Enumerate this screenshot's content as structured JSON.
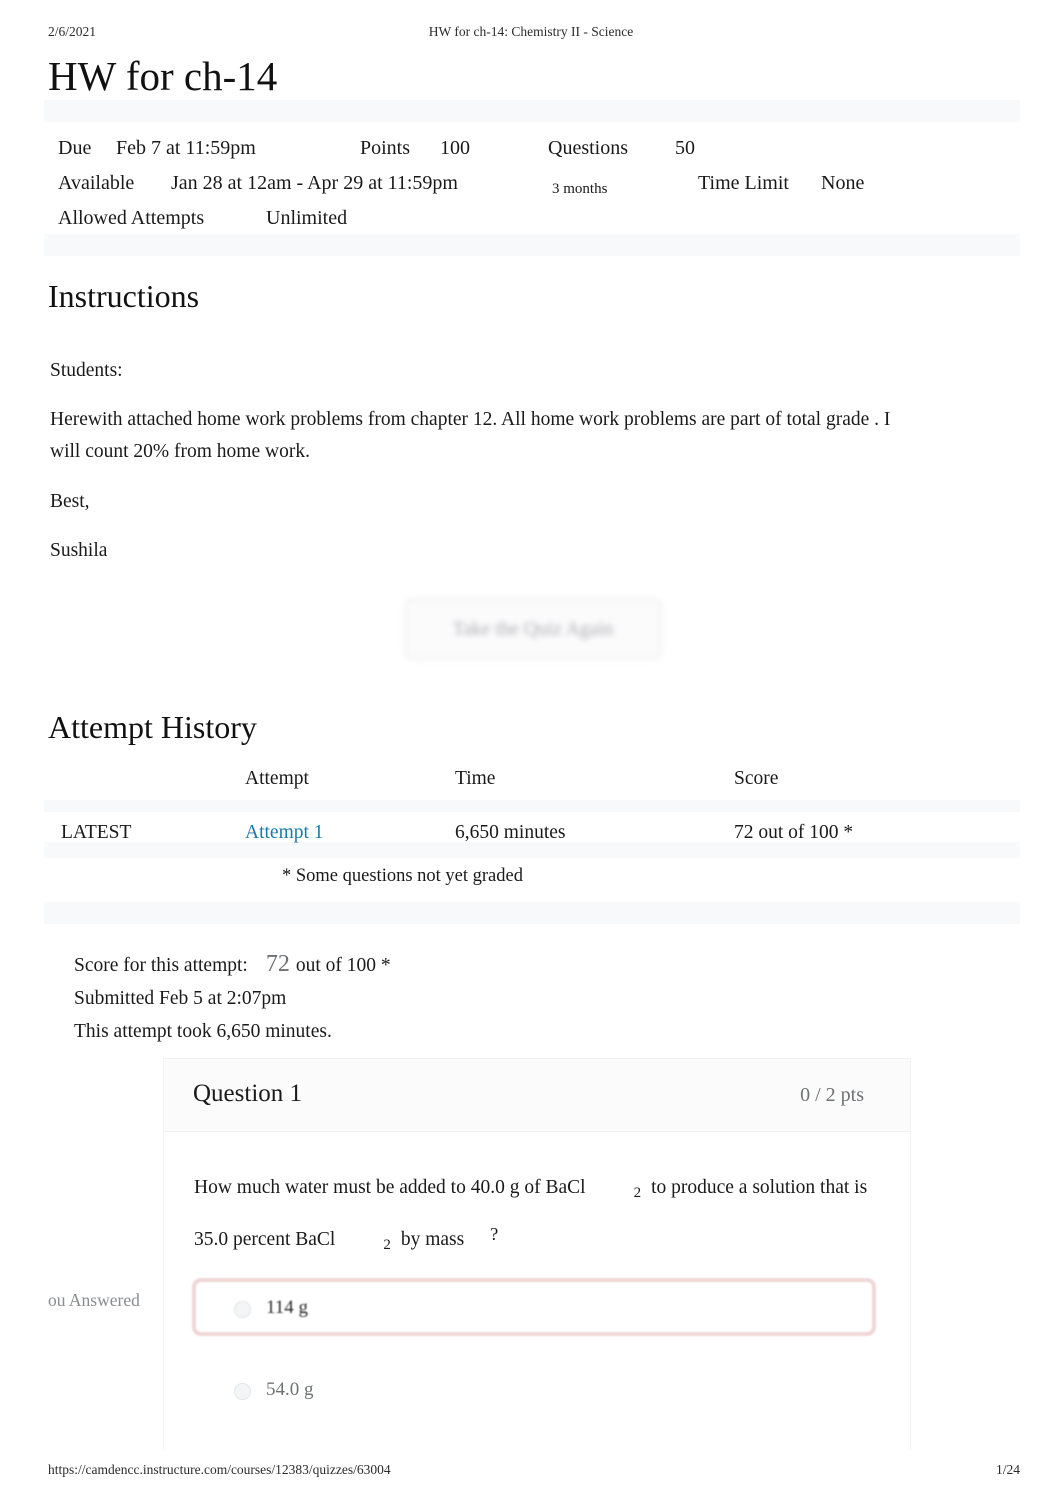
{
  "print": {
    "date": "2/6/2021",
    "doc_title": "HW for ch-14: Chemistry II - Science",
    "url": "https://camdencc.instructure.com/courses/12383/quizzes/63004",
    "page_number": "1/24"
  },
  "page": {
    "title": "HW for ch-14"
  },
  "quiz_meta": {
    "due_label": "Due",
    "due_value": "Feb 7 at 11:59pm",
    "points_label": "Points",
    "points_value": "100",
    "questions_label": "Questions",
    "questions_value": "50",
    "available_label": "Available",
    "available_value": "Jan 28 at 12am - Apr 29 at 11:59pm",
    "duration_value": "3 months",
    "time_limit_label": "Time Limit",
    "time_limit_value": "None",
    "allowed_attempts_label": "Allowed Attempts",
    "allowed_attempts_value": "Unlimited"
  },
  "instructions": {
    "heading": "Instructions",
    "salutation": "Students:",
    "body": "Herewith attached home work problems from chapter 12. All home work problems are part of total grade . I will count 20% from home work.",
    "closing": "Best,",
    "signature": "Sushila"
  },
  "actions": {
    "take_quiz_again": "Take the Quiz Again"
  },
  "attempt_history": {
    "heading": "Attempt History",
    "columns": [
      "",
      "Attempt",
      "Time",
      "Score"
    ],
    "rows": [
      {
        "marker": "LATEST",
        "attempt": "Attempt 1",
        "time": "6,650 minutes",
        "score": "72 out of 100 *"
      }
    ],
    "footnote": "* Some questions not yet graded"
  },
  "attempt_summary": {
    "score_label": "Score for this attempt:",
    "score_value": "72",
    "score_suffix": "out of 100 *",
    "submitted": "Submitted Feb 5 at 2:07pm",
    "duration": "This attempt took 6,650 minutes."
  },
  "question": {
    "title": "Question 1",
    "points": "0 / 2 pts",
    "text_part1": "How much water must be added to 40.0 g of BaCl",
    "sub1": "2",
    "text_part2": "to produce a solution that is 35.0 percent BaCl",
    "sub2": "2",
    "text_part3": "by mass",
    "text_part4": "?",
    "you_answered_label": "ou Answered",
    "answers": [
      {
        "text": "114 g",
        "selected": true
      },
      {
        "text": "54.0 g",
        "selected": false
      }
    ]
  },
  "colors": {
    "link": "#1a7ba8",
    "incorrect_highlight": "#f0d7d7",
    "muted_text": "#6f7173",
    "band": "#f8f9fa"
  }
}
